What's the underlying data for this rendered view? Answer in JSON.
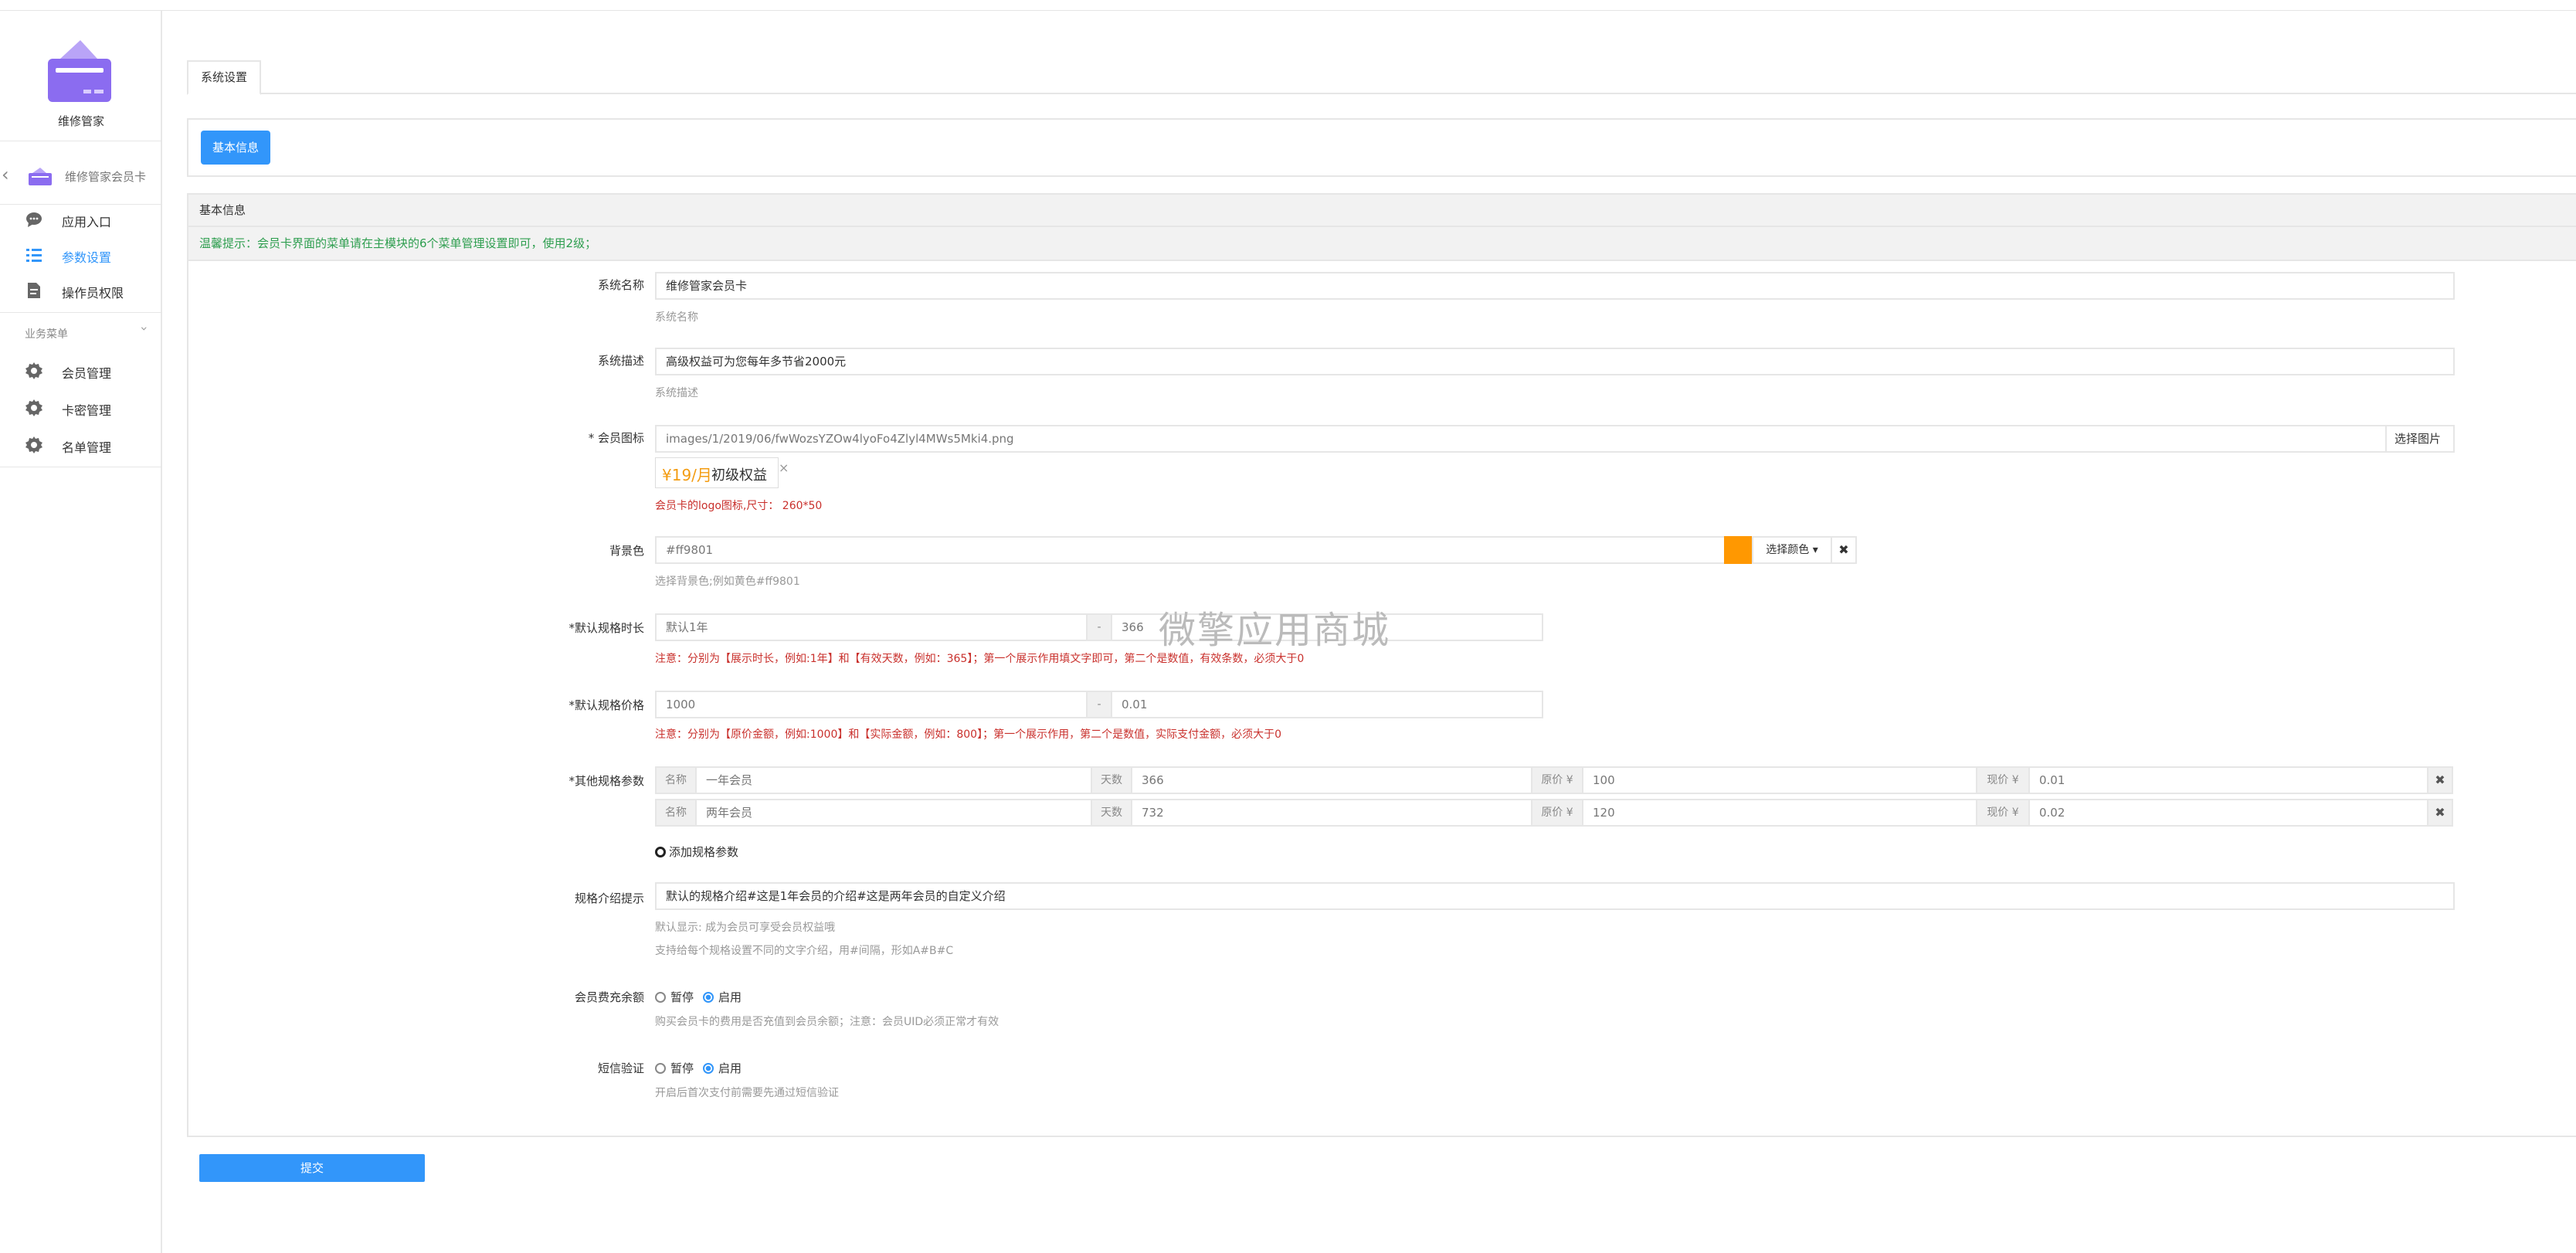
{
  "sidebar": {
    "app_name": "维修管家",
    "back_label": "维修管家会员卡",
    "items": [
      {
        "label": "应用入口",
        "icon": "chat-icon"
      },
      {
        "label": "参数设置",
        "icon": "list-icon"
      },
      {
        "label": "操作员权限",
        "icon": "document-icon"
      }
    ],
    "group_title": "业务菜单",
    "group_items": [
      {
        "label": "会员管理",
        "icon": "gear-icon"
      },
      {
        "label": "卡密管理",
        "icon": "gear-icon"
      },
      {
        "label": "名单管理",
        "icon": "gear-icon"
      }
    ]
  },
  "tabs": [
    "系统设置"
  ],
  "toolbar": {
    "basic_info_button": "基本信息"
  },
  "panel": {
    "title": "基本信息",
    "notice": "温馨提示：会员卡界面的菜单请在主模块的6个菜单管理设置即可，使用2级；"
  },
  "form": {
    "system_name": {
      "label": "系统名称",
      "value": "维修管家会员卡",
      "help": "系统名称"
    },
    "system_desc": {
      "label": "系统描述",
      "value": "高级权益可为您每年多节省2000元",
      "help": "系统描述"
    },
    "member_icon": {
      "label": "* 会员图标",
      "value": "images/1/2019/06/fwWozsYZOw4lyoFo4Zlyl4MWs5Mki4.png",
      "button": "选择图片",
      "preview_price": "¥19/月",
      "preview_text": "初级权益",
      "close": "×",
      "help": "会员卡的logo图标,尺寸： 260*50"
    },
    "bg_color": {
      "label": "背景色",
      "value": "#ff9801",
      "swatch": "#ff9801",
      "pick_button": "选择颜色 ▾",
      "clear": "✖",
      "help": "选择背景色;例如黄色#ff9801"
    },
    "default_duration": {
      "label": "*默认规格时长",
      "display_value": "默认1年",
      "sep": "-",
      "days_value": "366",
      "help": "注意：分别为【展示时长，例如:1年】和【有效天数，例如：365】；第一个展示作用填文字即可，第二个是数值，有效条数，必须大于0"
    },
    "default_price": {
      "label": "*默认规格价格",
      "original_value": "1000",
      "sep": "-",
      "actual_value": "0.01",
      "help": "注意：分别为【原价金额，例如:1000】和【实际金额，例如：800】；第一个展示作用，第二个是数值，实际支付金额，必须大于0"
    },
    "other_specs": {
      "label": "*其他规格参数",
      "addon_name": "名称",
      "addon_days": "天数",
      "addon_original": "原价 ¥",
      "addon_current": "现价 ¥",
      "remove": "✖",
      "rows": [
        {
          "name": "一年会员",
          "days": "366",
          "original": "100",
          "current": "0.01"
        },
        {
          "name": "两年会员",
          "days": "732",
          "original": "120",
          "current": "0.02"
        }
      ],
      "add_label": "添加规格参数"
    },
    "spec_intro": {
      "label": "规格介绍提示",
      "value": "默认的规格介绍#这是1年会员的介绍#这是两年会员的自定义介绍",
      "help1": "默认显示: 成为会员可享受会员权益哦",
      "help2": "支持给每个规格设置不同的文字介绍，用#间隔，形如A#B#C"
    },
    "recharge_balance": {
      "label": "会员费充余额",
      "opt_off": "暂停",
      "opt_on": "启用",
      "help": "购买会员卡的费用是否充值到会员余额；注意：会员UID必须正常才有效"
    },
    "sms_verify": {
      "label": "短信验证",
      "opt_off": "暂停",
      "opt_on": "启用",
      "help": "开启后首次支付前需要先通过短信验证"
    }
  },
  "submit_label": "提交",
  "watermark": "微擎应用商城",
  "colors": {
    "primary": "#3296fa",
    "notice_green": "#2e9e4f",
    "warning_red": "#c9302c",
    "logo_purple": "#8b6cf0"
  }
}
